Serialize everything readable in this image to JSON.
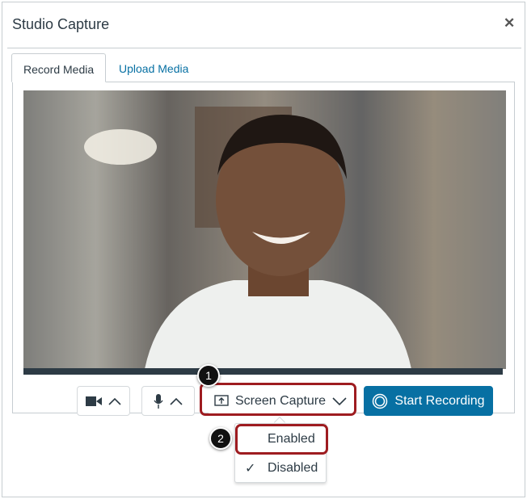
{
  "dialog": {
    "title": "Studio Capture",
    "close_icon": "close-icon"
  },
  "tabs": [
    {
      "label": "Record Media",
      "active": true
    },
    {
      "label": "Upload Media",
      "active": false
    }
  ],
  "controls": {
    "camera_icon": "video-camera-icon",
    "mic_icon": "microphone-icon",
    "screen_capture_label": "Screen Capture",
    "start_recording_label": "Start Recording"
  },
  "dropdown": {
    "options": [
      {
        "label": "Enabled",
        "checked": false
      },
      {
        "label": "Disabled",
        "checked": true
      }
    ]
  },
  "callouts": [
    "1",
    "2"
  ],
  "colors": {
    "primary": "#0770a3",
    "highlight": "#9e1c20"
  }
}
